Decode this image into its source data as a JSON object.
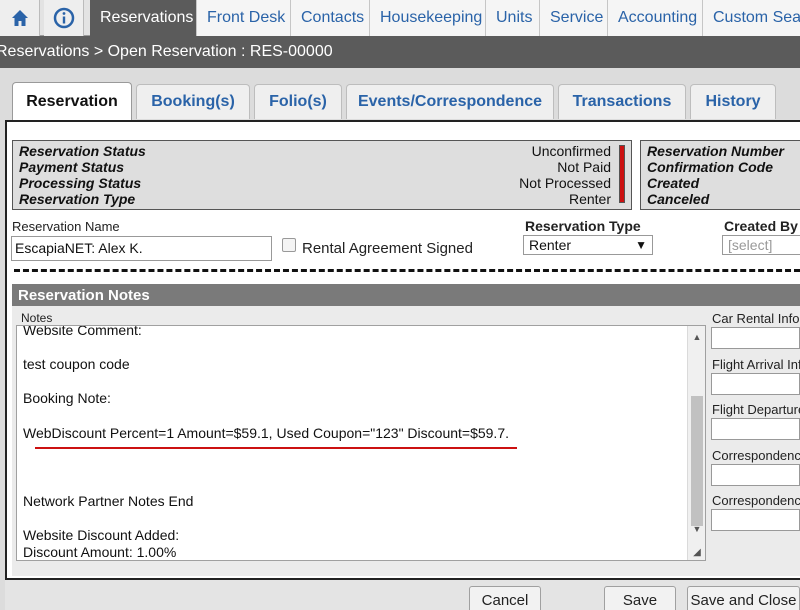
{
  "nav": {
    "icons": [
      "home-icon",
      "info-icon"
    ],
    "tabs": [
      "Reservations",
      "Front Desk",
      "Contacts",
      "Housekeeping",
      "Units",
      "Service",
      "Accounting",
      "Custom Sear"
    ],
    "active_tab": "Reservations"
  },
  "breadcrumb": "Reservations > Open Reservation : RES-00000",
  "subtabs": [
    "Reservation",
    "Booking(s)",
    "Folio(s)",
    "Events/Correspondence",
    "Transactions",
    "History"
  ],
  "active_subtab": "Reservation",
  "status": {
    "rows": [
      {
        "label": "Reservation Status",
        "value": "Unconfirmed"
      },
      {
        "label": "Payment Status",
        "value": "Not Paid"
      },
      {
        "label": "Processing Status",
        "value": "Not Processed"
      },
      {
        "label": "Reservation Type",
        "value": "Renter"
      }
    ],
    "indicator_color": "#cc1111"
  },
  "info_labels": [
    "Reservation Number",
    "Confirmation Code",
    "Created",
    "Canceled"
  ],
  "form": {
    "name_label": "Reservation Name",
    "name_value": "EscapiaNET: Alex K.",
    "rental_agreement_label": "Rental Agreement Signed",
    "rental_agreement_checked": false,
    "type_label": "Reservation Type",
    "type_value": "Renter",
    "created_by_label": "Created By",
    "created_by_value": "[select]"
  },
  "notes": {
    "section_title": "Reservation Notes",
    "notes_label": "Notes",
    "lines": [
      "Website Comment:",
      "",
      "test coupon code",
      "",
      "Booking Note:",
      "",
      "WebDiscount Percent=1 Amount=$59.1, Used Coupon=\"123\" Discount=$59.7.",
      "",
      "",
      "",
      "Network Partner Notes End",
      "",
      "Website Discount Added:",
      "Discount Amount: 1.00%"
    ],
    "highlight_color": "#cc1111"
  },
  "side_fields": [
    "Car Rental Infor",
    "Flight Arrival Inf",
    "Flight Departure",
    "Correspondence",
    "Correspondence"
  ],
  "buttons": {
    "cancel": "Cancel",
    "save": "Save",
    "save_close": "Save and Close"
  },
  "colors": {
    "link_blue": "#2a63a8",
    "dark_bar": "#5b5b5b"
  }
}
